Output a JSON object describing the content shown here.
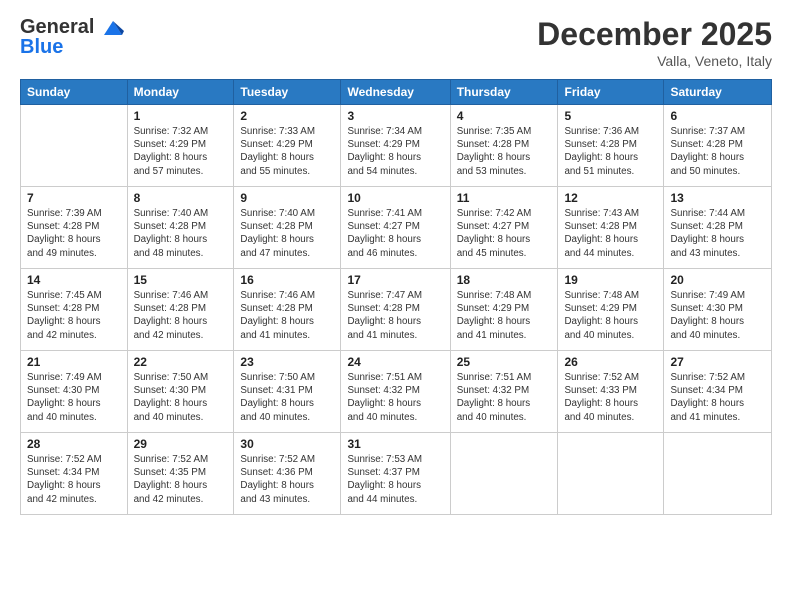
{
  "logo": {
    "line1": "General",
    "line2": "Blue"
  },
  "header": {
    "month": "December 2025",
    "location": "Valla, Veneto, Italy"
  },
  "weekdays": [
    "Sunday",
    "Monday",
    "Tuesday",
    "Wednesday",
    "Thursday",
    "Friday",
    "Saturday"
  ],
  "weeks": [
    [
      {
        "day": "",
        "info": ""
      },
      {
        "day": "1",
        "info": "Sunrise: 7:32 AM\nSunset: 4:29 PM\nDaylight: 8 hours\nand 57 minutes."
      },
      {
        "day": "2",
        "info": "Sunrise: 7:33 AM\nSunset: 4:29 PM\nDaylight: 8 hours\nand 55 minutes."
      },
      {
        "day": "3",
        "info": "Sunrise: 7:34 AM\nSunset: 4:29 PM\nDaylight: 8 hours\nand 54 minutes."
      },
      {
        "day": "4",
        "info": "Sunrise: 7:35 AM\nSunset: 4:28 PM\nDaylight: 8 hours\nand 53 minutes."
      },
      {
        "day": "5",
        "info": "Sunrise: 7:36 AM\nSunset: 4:28 PM\nDaylight: 8 hours\nand 51 minutes."
      },
      {
        "day": "6",
        "info": "Sunrise: 7:37 AM\nSunset: 4:28 PM\nDaylight: 8 hours\nand 50 minutes."
      }
    ],
    [
      {
        "day": "7",
        "info": "Sunrise: 7:39 AM\nSunset: 4:28 PM\nDaylight: 8 hours\nand 49 minutes."
      },
      {
        "day": "8",
        "info": "Sunrise: 7:40 AM\nSunset: 4:28 PM\nDaylight: 8 hours\nand 48 minutes."
      },
      {
        "day": "9",
        "info": "Sunrise: 7:40 AM\nSunset: 4:28 PM\nDaylight: 8 hours\nand 47 minutes."
      },
      {
        "day": "10",
        "info": "Sunrise: 7:41 AM\nSunset: 4:27 PM\nDaylight: 8 hours\nand 46 minutes."
      },
      {
        "day": "11",
        "info": "Sunrise: 7:42 AM\nSunset: 4:27 PM\nDaylight: 8 hours\nand 45 minutes."
      },
      {
        "day": "12",
        "info": "Sunrise: 7:43 AM\nSunset: 4:28 PM\nDaylight: 8 hours\nand 44 minutes."
      },
      {
        "day": "13",
        "info": "Sunrise: 7:44 AM\nSunset: 4:28 PM\nDaylight: 8 hours\nand 43 minutes."
      }
    ],
    [
      {
        "day": "14",
        "info": "Sunrise: 7:45 AM\nSunset: 4:28 PM\nDaylight: 8 hours\nand 42 minutes."
      },
      {
        "day": "15",
        "info": "Sunrise: 7:46 AM\nSunset: 4:28 PM\nDaylight: 8 hours\nand 42 minutes."
      },
      {
        "day": "16",
        "info": "Sunrise: 7:46 AM\nSunset: 4:28 PM\nDaylight: 8 hours\nand 41 minutes."
      },
      {
        "day": "17",
        "info": "Sunrise: 7:47 AM\nSunset: 4:28 PM\nDaylight: 8 hours\nand 41 minutes."
      },
      {
        "day": "18",
        "info": "Sunrise: 7:48 AM\nSunset: 4:29 PM\nDaylight: 8 hours\nand 41 minutes."
      },
      {
        "day": "19",
        "info": "Sunrise: 7:48 AM\nSunset: 4:29 PM\nDaylight: 8 hours\nand 40 minutes."
      },
      {
        "day": "20",
        "info": "Sunrise: 7:49 AM\nSunset: 4:30 PM\nDaylight: 8 hours\nand 40 minutes."
      }
    ],
    [
      {
        "day": "21",
        "info": "Sunrise: 7:49 AM\nSunset: 4:30 PM\nDaylight: 8 hours\nand 40 minutes."
      },
      {
        "day": "22",
        "info": "Sunrise: 7:50 AM\nSunset: 4:30 PM\nDaylight: 8 hours\nand 40 minutes."
      },
      {
        "day": "23",
        "info": "Sunrise: 7:50 AM\nSunset: 4:31 PM\nDaylight: 8 hours\nand 40 minutes."
      },
      {
        "day": "24",
        "info": "Sunrise: 7:51 AM\nSunset: 4:32 PM\nDaylight: 8 hours\nand 40 minutes."
      },
      {
        "day": "25",
        "info": "Sunrise: 7:51 AM\nSunset: 4:32 PM\nDaylight: 8 hours\nand 40 minutes."
      },
      {
        "day": "26",
        "info": "Sunrise: 7:52 AM\nSunset: 4:33 PM\nDaylight: 8 hours\nand 40 minutes."
      },
      {
        "day": "27",
        "info": "Sunrise: 7:52 AM\nSunset: 4:34 PM\nDaylight: 8 hours\nand 41 minutes."
      }
    ],
    [
      {
        "day": "28",
        "info": "Sunrise: 7:52 AM\nSunset: 4:34 PM\nDaylight: 8 hours\nand 42 minutes."
      },
      {
        "day": "29",
        "info": "Sunrise: 7:52 AM\nSunset: 4:35 PM\nDaylight: 8 hours\nand 42 minutes."
      },
      {
        "day": "30",
        "info": "Sunrise: 7:52 AM\nSunset: 4:36 PM\nDaylight: 8 hours\nand 43 minutes."
      },
      {
        "day": "31",
        "info": "Sunrise: 7:53 AM\nSunset: 4:37 PM\nDaylight: 8 hours\nand 44 minutes."
      },
      {
        "day": "",
        "info": ""
      },
      {
        "day": "",
        "info": ""
      },
      {
        "day": "",
        "info": ""
      }
    ]
  ]
}
